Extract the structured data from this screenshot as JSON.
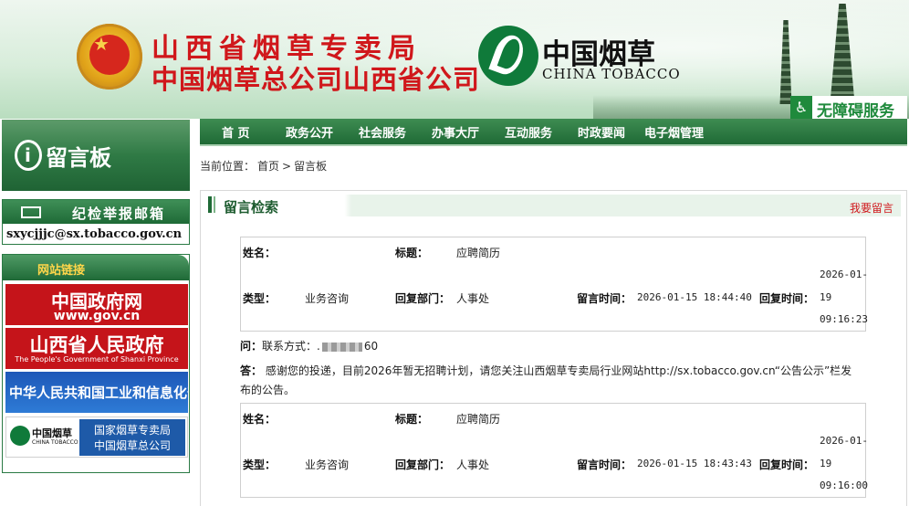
{
  "header": {
    "org_line1": "山西省烟草专卖局",
    "org_line2": "中国烟草总公司山西省公司",
    "brand_cn": "中国烟草",
    "brand_en": "CHINA TOBACCO",
    "accessibility": "无障碍服务",
    "accessibility_icon": "wheelchair-icon"
  },
  "nav": {
    "items": [
      "首 页",
      "政务公开",
      "社会服务",
      "办事大厅",
      "互动服务",
      "时政要闻",
      "电子烟管理"
    ]
  },
  "breadcrumb": {
    "prefix": "当前位置：",
    "home": "首页",
    "sep": ">",
    "current": "留言板"
  },
  "sidebar": {
    "title": "留言板",
    "title_icon": "info-icon",
    "mailbox": {
      "title": "纪检举报邮箱",
      "address": "sxycjjjc@sx.tobacco.gov.cn",
      "icon": "envelope-icon"
    },
    "links": {
      "title": "网站链接",
      "gov_cn": {
        "name": "中国政府网",
        "url_text": "www.gov.cn"
      },
      "shanxi_gov": {
        "name": "山西省人民政府",
        "en": "The People's Government of Shanxi Province"
      },
      "miit": {
        "name": "中华人民共和国工业和信息化部"
      },
      "tobacco": {
        "logo_cn": "中国烟草",
        "logo_en": "CHINA TOBACCO",
        "line1": "国家烟草专卖局",
        "line2": "中国烟草总公司"
      }
    }
  },
  "main": {
    "section_title": "留言检索",
    "post_label": "我要留言",
    "labels": {
      "name": "姓名：",
      "title": "标题：",
      "type": "类型：",
      "reply_dept": "回复部门：",
      "msg_time": "留言时间：",
      "reply_time": "回复时间："
    },
    "records": [
      {
        "name": "",
        "title": "应聘简历",
        "type": "业务咨询",
        "reply_dept": "人事处",
        "msg_time": "2026-01-15 18:44:40",
        "reply_time_date_a": "2026-01-",
        "reply_time_date_b": "19",
        "reply_time_time": "09:16:23"
      },
      {
        "name": "",
        "title": "应聘简历",
        "type": "业务咨询",
        "reply_dept": "人事处",
        "msg_time": "2026-01-15 18:43:43",
        "reply_time_date_a": "2026-01-",
        "reply_time_date_b": "19",
        "reply_time_time": "09:16:00"
      }
    ],
    "qa1": {
      "q_label": "问：",
      "q_prefix": "联系方式：",
      "q_suffix": "60",
      "a_label": "答：",
      "a_line1": "感谢您的投递，目前2026年暂无招聘计划，请您关注山西烟草专卖局行业网站http://sx.tobacco.gov.cn“公告公示”栏发",
      "a_line2": "布的公告。"
    }
  }
}
